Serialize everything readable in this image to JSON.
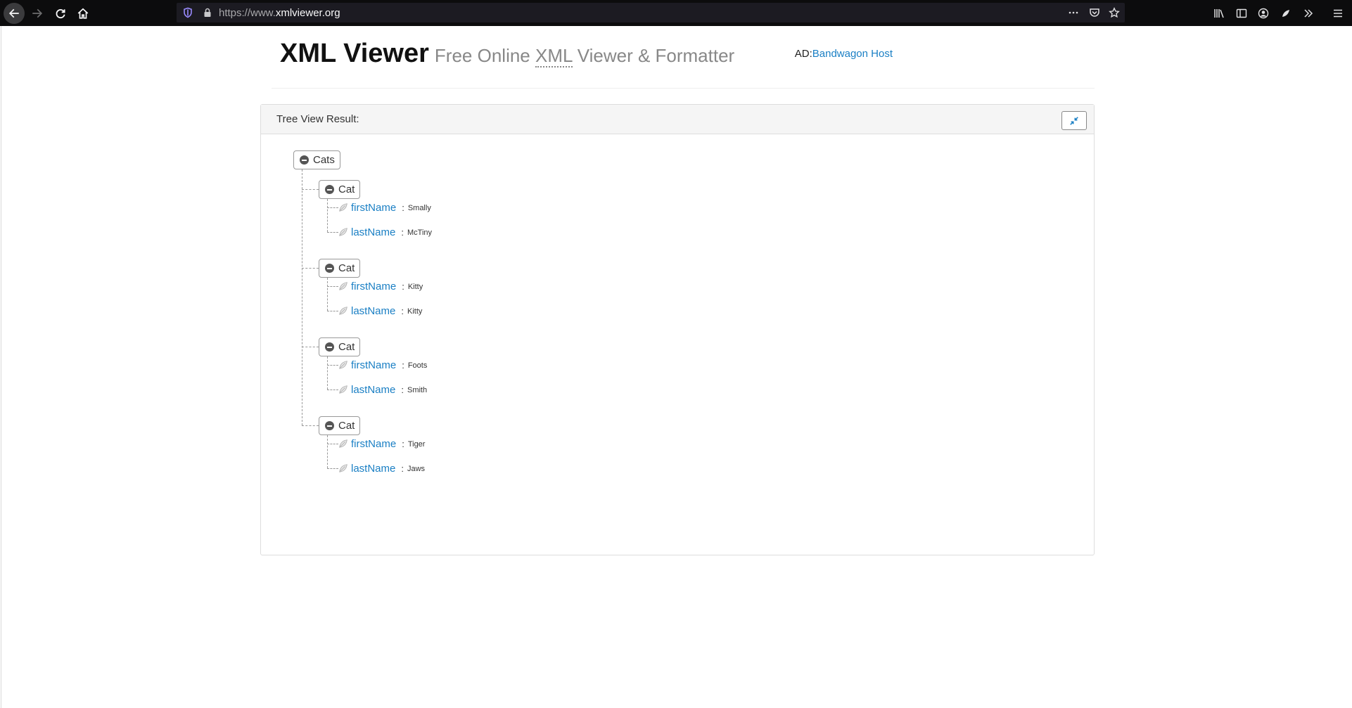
{
  "browser": {
    "url_prefix": "https://www.",
    "url_host": "xmlviewer.org"
  },
  "header": {
    "title": "XML Viewer",
    "subtitle_pre": "Free Online ",
    "subtitle_abbr": "XML",
    "subtitle_post": " Viewer & Formatter"
  },
  "ad": {
    "prefix": "AD:",
    "link_text": "Bandwagon Host"
  },
  "panel": {
    "title": "Tree View Result:"
  },
  "tree": {
    "root": "Cats",
    "children": [
      {
        "name": "Cat",
        "fields": [
          {
            "key": "firstName",
            "value": "Smally"
          },
          {
            "key": "lastName",
            "value": "McTiny"
          }
        ]
      },
      {
        "name": "Cat",
        "fields": [
          {
            "key": "firstName",
            "value": "Kitty"
          },
          {
            "key": "lastName",
            "value": "Kitty"
          }
        ]
      },
      {
        "name": "Cat",
        "fields": [
          {
            "key": "firstName",
            "value": "Foots"
          },
          {
            "key": "lastName",
            "value": "Smith"
          }
        ]
      },
      {
        "name": "Cat",
        "fields": [
          {
            "key": "firstName",
            "value": "Tiger"
          },
          {
            "key": "lastName",
            "value": "Jaws"
          }
        ]
      }
    ]
  },
  "colors": {
    "link": "#1a7fc4",
    "chrome": "#0c0c0d"
  }
}
